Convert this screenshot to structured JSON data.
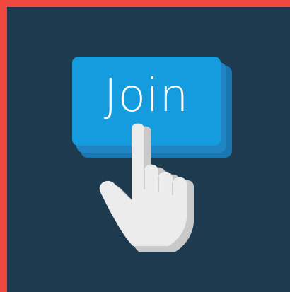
{
  "button": {
    "label": "Join"
  },
  "colors": {
    "border": "#f0483e",
    "background": "#1e3a4f",
    "button_face": "#159cde",
    "button_side": "#1f85c4",
    "hand": "#ececec",
    "hand_shadow": "#c9c9c9"
  },
  "icons": {
    "pointer": "pointing-hand-icon"
  }
}
